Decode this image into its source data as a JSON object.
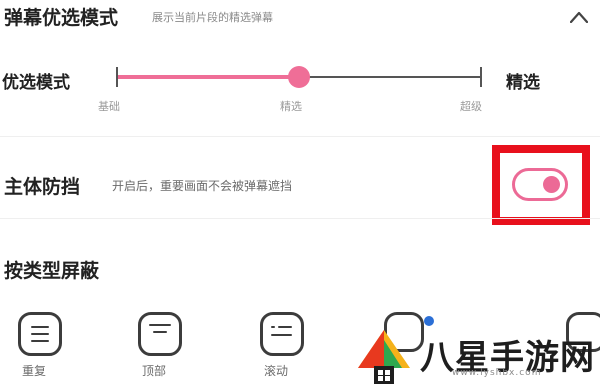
{
  "priority": {
    "title": "弹幕优选模式",
    "subtitle": "展示当前片段的精选弹幕",
    "mode_label_left": "优选模式",
    "mode_label_right": "精选",
    "levels": [
      "基础",
      "精选",
      "超级"
    ],
    "selected_level": "精选",
    "slider_fraction": 0.5
  },
  "shield": {
    "title": "主体防挡",
    "description": "开启后，重要画面不会被弹幕遮挡",
    "toggle_on": true
  },
  "block_types": {
    "title": "按类型屏蔽",
    "items": [
      {
        "label": "重复",
        "icon": "list-icon"
      },
      {
        "label": "顶部",
        "icon": "top-icon"
      },
      {
        "label": "滚动",
        "icon": "scroll-icon"
      }
    ]
  },
  "watermark": {
    "brand": "八星手游网",
    "url": "www.lyshbx.com"
  },
  "colors": {
    "accent": "#ef6e97",
    "highlight_box": "#e8101c",
    "text_primary": "#222222",
    "text_secondary": "#8a8a8a"
  }
}
